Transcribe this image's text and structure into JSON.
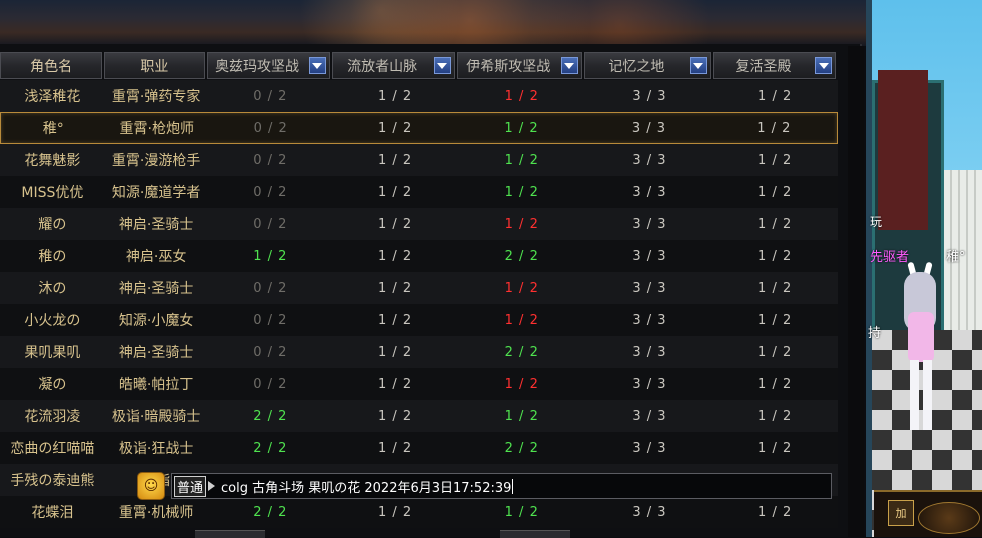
{
  "header": {
    "columns": [
      {
        "label": "角色名",
        "sortable": false
      },
      {
        "label": "职业",
        "sortable": false
      },
      {
        "label": "奥兹玛攻坚战",
        "sortable": true
      },
      {
        "label": "流放者山脉",
        "sortable": true
      },
      {
        "label": "伊希斯攻坚战",
        "sortable": true
      },
      {
        "label": "记忆之地",
        "sortable": true
      },
      {
        "label": "复活圣殿",
        "sortable": true
      }
    ]
  },
  "rows": [
    {
      "name": "浅泽稚花",
      "job": "重霄·弹药专家",
      "vals": [
        "0 / 2",
        "1 / 2",
        "1 / 2",
        "3 / 3",
        "1 / 2"
      ],
      "colors": [
        "grey",
        "white",
        "red",
        "white",
        "white"
      ]
    },
    {
      "name": "稚°",
      "job": "重霄·枪炮师",
      "vals": [
        "0 / 2",
        "1 / 2",
        "1 / 2",
        "3 / 3",
        "1 / 2"
      ],
      "colors": [
        "grey",
        "white",
        "green",
        "white",
        "white"
      ],
      "selected": true
    },
    {
      "name": "花舞魅影",
      "job": "重霄·漫游枪手",
      "vals": [
        "0 / 2",
        "1 / 2",
        "1 / 2",
        "3 / 3",
        "1 / 2"
      ],
      "colors": [
        "grey",
        "white",
        "green",
        "white",
        "white"
      ]
    },
    {
      "name": "MISS优优",
      "job": "知源·魔道学者",
      "vals": [
        "0 / 2",
        "1 / 2",
        "1 / 2",
        "3 / 3",
        "1 / 2"
      ],
      "colors": [
        "grey",
        "white",
        "green",
        "white",
        "white"
      ]
    },
    {
      "name": "耀の",
      "job": "神启·圣骑士",
      "vals": [
        "0 / 2",
        "1 / 2",
        "1 / 2",
        "3 / 3",
        "1 / 2"
      ],
      "colors": [
        "grey",
        "white",
        "red",
        "white",
        "white"
      ]
    },
    {
      "name": "稚の",
      "job": "神启·巫女",
      "vals": [
        "1 / 2",
        "1 / 2",
        "2 / 2",
        "3 / 3",
        "1 / 2"
      ],
      "colors": [
        "green",
        "white",
        "green",
        "white",
        "white"
      ]
    },
    {
      "name": "沐の",
      "job": "神启·圣骑士",
      "vals": [
        "0 / 2",
        "1 / 2",
        "1 / 2",
        "3 / 3",
        "1 / 2"
      ],
      "colors": [
        "grey",
        "white",
        "red",
        "white",
        "white"
      ]
    },
    {
      "name": "小火龙の",
      "job": "知源·小魔女",
      "vals": [
        "0 / 2",
        "1 / 2",
        "1 / 2",
        "3 / 3",
        "1 / 2"
      ],
      "colors": [
        "grey",
        "white",
        "red",
        "white",
        "white"
      ]
    },
    {
      "name": "果叽果叽",
      "job": "神启·圣骑士",
      "vals": [
        "0 / 2",
        "1 / 2",
        "2 / 2",
        "3 / 3",
        "1 / 2"
      ],
      "colors": [
        "grey",
        "white",
        "green",
        "white",
        "white"
      ]
    },
    {
      "name": "凝の",
      "job": "皓曦·帕拉丁",
      "vals": [
        "0 / 2",
        "1 / 2",
        "1 / 2",
        "3 / 3",
        "1 / 2"
      ],
      "colors": [
        "grey",
        "white",
        "red",
        "white",
        "white"
      ]
    },
    {
      "name": "花流羽凌",
      "job": "极诣·暗殿骑士",
      "vals": [
        "2 / 2",
        "1 / 2",
        "1 / 2",
        "3 / 3",
        "1 / 2"
      ],
      "colors": [
        "green",
        "white",
        "green",
        "white",
        "white"
      ]
    },
    {
      "name": "恋曲の红喵喵",
      "job": "极诣·狂战士",
      "vals": [
        "2 / 2",
        "1 / 2",
        "2 / 2",
        "3 / 3",
        "1 / 2"
      ],
      "colors": [
        "green",
        "white",
        "green",
        "white",
        "white"
      ]
    },
    {
      "name": "手残の泰迪熊",
      "job": "极诣",
      "vals": [
        "",
        "",
        "",
        "",
        ""
      ],
      "colors": [
        "grey",
        "white",
        "white",
        "white",
        "white"
      ]
    },
    {
      "name": "花蝶泪",
      "job": "重霄·机械师",
      "vals": [
        "2 / 2",
        "1 / 2",
        "1 / 2",
        "3 / 3",
        "1 / 2"
      ],
      "colors": [
        "green",
        "white",
        "green",
        "white",
        "white"
      ]
    }
  ],
  "chat": {
    "channel": "普通",
    "text": "colg 古角斗场 果叽の花 2022年6月3日17:52:39"
  },
  "scene": {
    "tag1": "玩",
    "tag2": "先驱者",
    "tag3": "稚°",
    "tag4": "持"
  },
  "hud": {
    "button_label": "加"
  },
  "colors": {
    "green": "#4fe24f",
    "red": "#ff3030",
    "grey": "#6f6d68",
    "white": "#c9c6bf",
    "gold_text": "#d7c28d"
  }
}
